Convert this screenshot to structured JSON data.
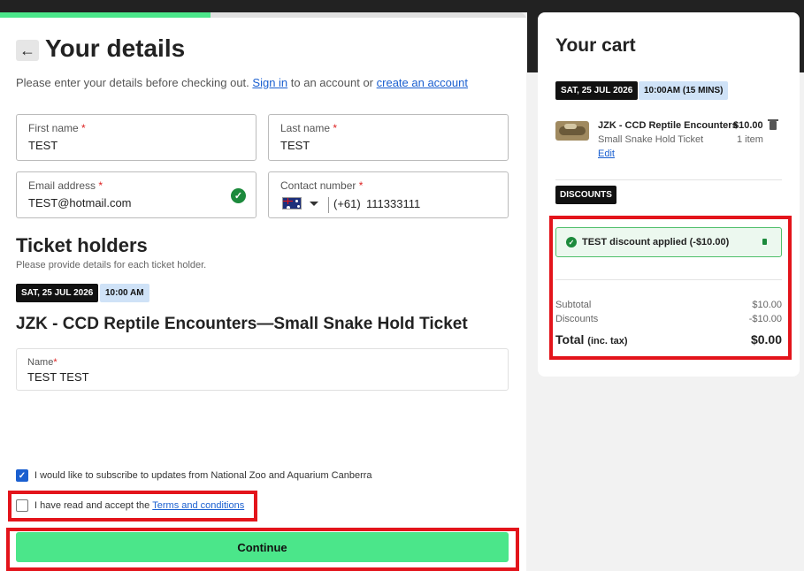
{
  "page": {
    "title": "Your details",
    "intro_text": "Please enter your details before checking out.",
    "sign_in_link": "Sign in",
    "intro_middle": "to an account or",
    "create_account_link": "create an account"
  },
  "form": {
    "first_name": {
      "label": "First name",
      "value": "TEST"
    },
    "last_name": {
      "label": "Last name",
      "value": "TEST"
    },
    "email": {
      "label": "Email address",
      "value": "TEST@hotmail.com"
    },
    "contact": {
      "label": "Contact number",
      "country_code": "(+61)",
      "value": "111333111"
    },
    "required_marker": "*"
  },
  "ticket_holders": {
    "title": "Ticket holders",
    "subtitle": "Please provide details for each ticket holder.",
    "date": "SAT, 25 JUL 2026",
    "time": "10:00 AM",
    "ticket_title": "JZK - CCD Reptile Encounters—Small Snake Hold Ticket",
    "name_label": "Name",
    "name_value": "TEST TEST"
  },
  "consents": {
    "subscribe_label": "I would like to subscribe to updates from National Zoo and Aquarium Canberra",
    "subscribe_checked": true,
    "terms_prefix": "I have read and accept the",
    "terms_link": "Terms and conditions",
    "terms_checked": false
  },
  "continue_label": "Continue",
  "progress_fraction": 0.4,
  "cart": {
    "title": "Your cart",
    "date": "SAT, 25 JUL 2026",
    "time": "10:00AM (15 MINS)",
    "item_name": "JZK - CCD Reptile Encounters",
    "item_price": "$10.00",
    "item_sub": "Small Snake Hold Ticket",
    "item_qty": "1 item",
    "edit_label": "Edit",
    "discounts_label": "DISCOUNTS",
    "discount_applied": "TEST discount applied (-$10.00)",
    "subtotal_label": "Subtotal",
    "subtotal_value": "$10.00",
    "discounts_row_label": "Discounts",
    "discounts_value": "-$10.00",
    "total_label": "Total",
    "total_tax": "(inc. tax)",
    "total_value": "$0.00"
  },
  "colors": {
    "accent_green": "#4be68a",
    "link_blue": "#1a5fd0",
    "highlight_red": "#e3141b"
  }
}
